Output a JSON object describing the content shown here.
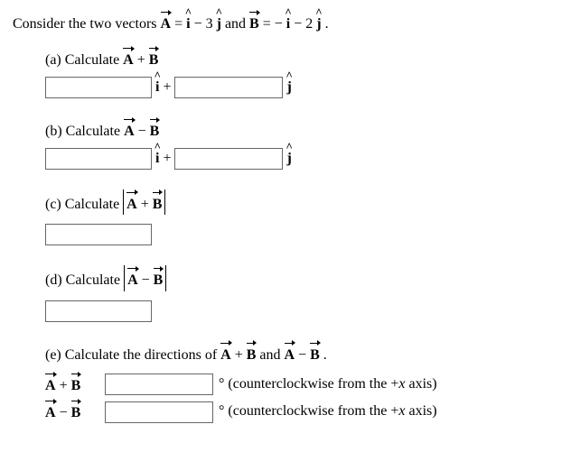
{
  "prompt": {
    "intro": "Consider the two vectors ",
    "eq_mid": " = ",
    "A_expr_i": " − 3 ",
    "and_text": " and ",
    "B_expr_pre": " = − ",
    "B_expr_mid": " − 2 ",
    "period": "."
  },
  "vec": {
    "A": "A",
    "B": "B"
  },
  "hat": {
    "i": "i",
    "j": "j"
  },
  "parts": {
    "a": {
      "label": "(a) Calculate ",
      "op": " + "
    },
    "b": {
      "label": "(b) Calculate ",
      "op": " − "
    },
    "c": {
      "label": "(c) Calculate ",
      "op": " + "
    },
    "d": {
      "label": "(d) Calculate ",
      "op": " − "
    },
    "e": {
      "label": "(e) Calculate the directions of ",
      "and": " and ",
      "plus": " + ",
      "minus": " − ",
      "period": "."
    }
  },
  "glue": {
    "ihat_plus": " + ",
    "deg": "°",
    "ccw_pre": " (counterclockwise from the +",
    "x": "x",
    "ccw_post": " axis)"
  }
}
